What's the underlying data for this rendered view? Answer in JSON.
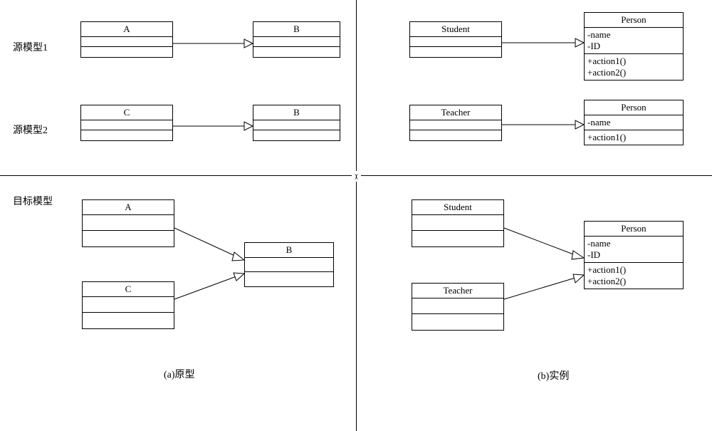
{
  "labels": {
    "source1": "源模型1",
    "source2": "源模型2",
    "target": "目标模型",
    "caption_a": "(a)原型",
    "caption_b": "(b)实例"
  },
  "classes": {
    "A": "A",
    "B": "B",
    "C": "C",
    "Student": "Student",
    "Teacher": "Teacher",
    "Person": "Person"
  },
  "attrs": {
    "name": "-name",
    "id": "-ID"
  },
  "ops": {
    "action1": "+action1()",
    "action2": "+action2()"
  }
}
